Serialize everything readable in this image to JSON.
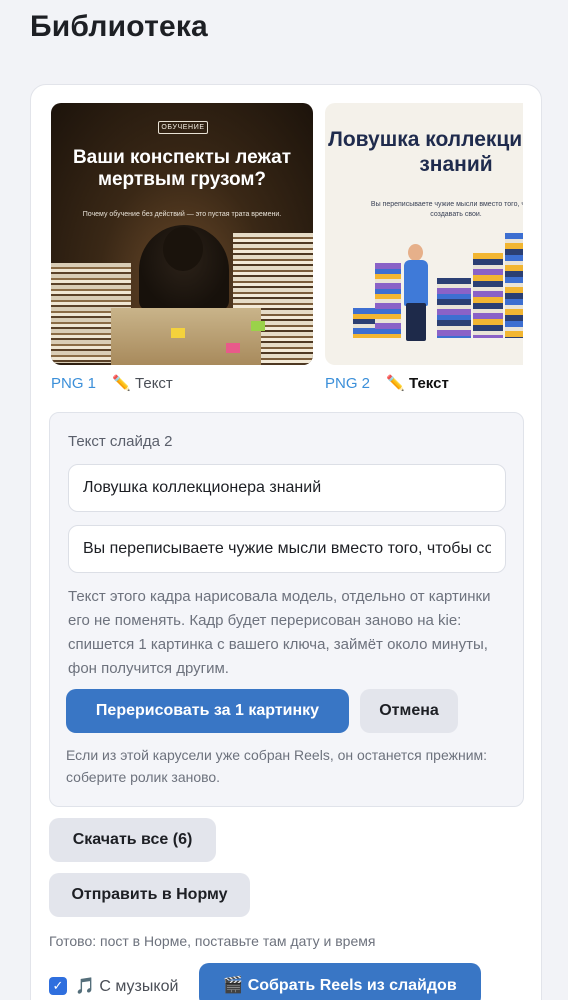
{
  "page": {
    "title": "Библиотека"
  },
  "slides": [
    {
      "png_label": "PNG 1",
      "edit_label": "✏️ Текст",
      "thumb": {
        "tag": "ОБУЧЕНИЕ",
        "title": "Ваши конспекты лежат мертвым грузом?",
        "subtitle": "Почему обучение без действий — это пустая трата времени."
      }
    },
    {
      "png_label": "PNG 2",
      "edit_label": "✏️ Текст",
      "active": true,
      "thumb": {
        "title": "Ловушка коллекционера знаний",
        "subtitle": "Вы переписываете чужие мысли вместо того, чтобы создавать свои."
      }
    }
  ],
  "edit_panel": {
    "heading": "Текст слайда 2",
    "title_value": "Ловушка коллекционера знаний",
    "subtitle_value": "Вы переписываете чужие мысли вместо того, чтобы создавать свои.",
    "notice": "Текст этого кадра нарисовала модель, отдельно от картинки его не поменять. Кадр будет перерисован заново на kie: спишется 1 картинка с вашего ключа, займёт около минуты, фон получится другим.",
    "redraw_label": "Перерисовать за 1 картинку",
    "cancel_label": "Отмена",
    "reels_note": "Если из этой карусели уже собран Reels, он останется прежним: соберите ролик заново."
  },
  "actions": {
    "download_all_label": "Скачать все (6)",
    "send_label": "Отправить в Норму",
    "status": "Готово: пост в Норме, поставьте там дату и время",
    "music_checked": true,
    "music_label": "🎵 С музыкой",
    "reels_label": "🎬 Собрать Reels из слайдов"
  },
  "colors": {
    "accent": "#3976c5",
    "link": "#3b8fd9",
    "background": "#f2f3f7"
  }
}
